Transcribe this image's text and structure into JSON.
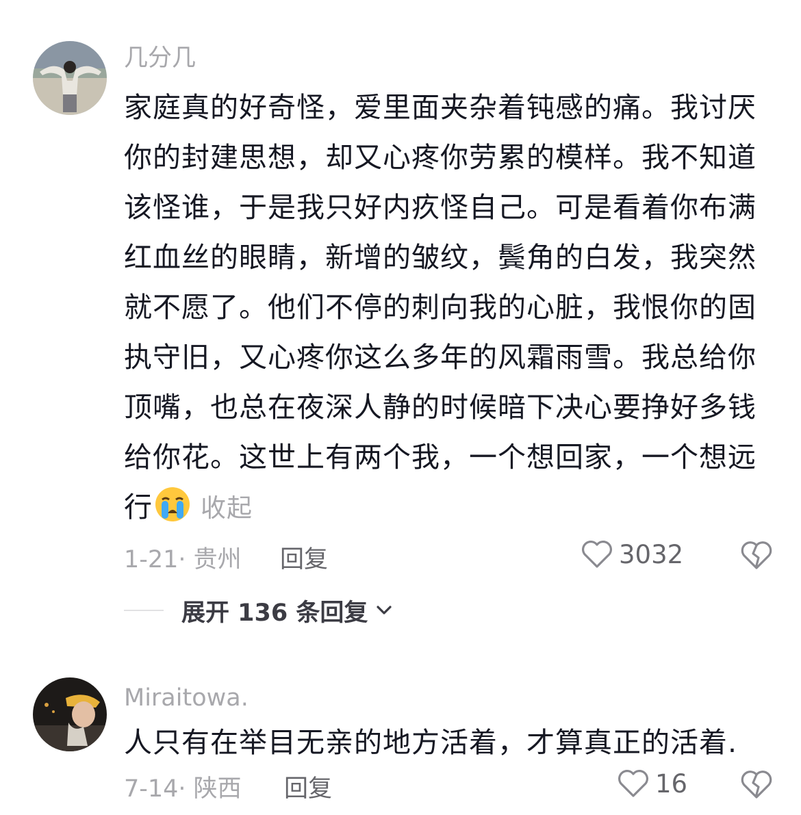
{
  "comments": [
    {
      "username": "几分几",
      "text": "家庭真的好奇怪，爱里面夹杂着钝感的痛。我讨厌你的封建思想，却又心疼你劳累的模样。我不知道该怪谁，于是我只好内疚怪自己。可是看着你布满红血丝的眼睛，新增的皱纹，鬓角的白发，我突然就不愿了。他们不停的刺向我的心脏，我恨你的固执守旧，又心疼你这么多年的风霜雨雪。我总给你顶嘴，也总在夜深人静的时候暗下决心要挣好多钱给你花。这世上有两个我，一个想回家，一个想远行",
      "emoji": "crying-face",
      "collapse_label": "收起",
      "date_location": "1-21· 贵州",
      "reply_label": "回复",
      "likes": "3032",
      "expand_replies_label": "展开 136 条回复"
    },
    {
      "username": "Miraitowa.",
      "text": "人只有在举目无亲的地方活着，才算真正的活着.",
      "date_location": "7-14· 陕西",
      "reply_label": "回复",
      "likes": "16"
    }
  ]
}
